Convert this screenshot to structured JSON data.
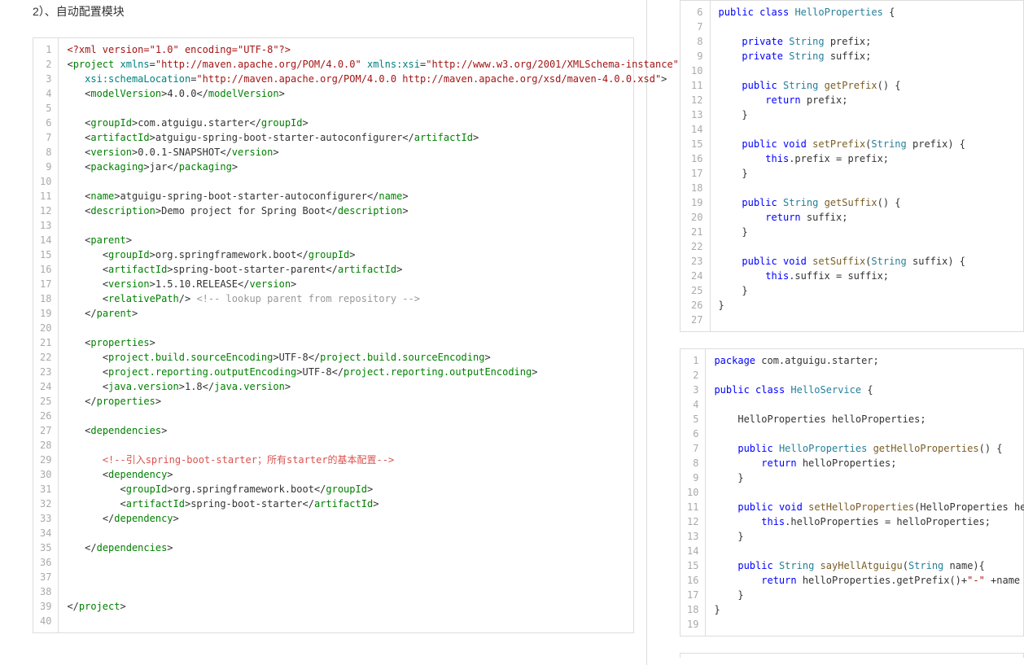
{
  "heading": "2）、自动配置模块",
  "xml": {
    "l1": "<?xml version=\"1.0\" encoding=\"UTF-8\"?>",
    "l2a": "project",
    "l2b": "xmlns",
    "l2c": "\"http://maven.apache.org/POM/4.0.0\"",
    "l2d": "xmlns:xsi",
    "l2e": "\"http://www.w3.org/2001/XMLSchema-instance\"",
    "l3a": "xsi:schemaLocation",
    "l3b": "\"http://maven.apache.org/POM/4.0.0 http://maven.apache.org/xsd/maven-4.0.0.xsd\"",
    "l4a": "modelVersion",
    "l4b": "4.0.0",
    "l6a": "groupId",
    "l6b": "com.atguigu.starter",
    "l7a": "artifactId",
    "l7b": "atguigu-spring-boot-starter-autoconfigurer",
    "l8a": "version",
    "l8b": "0.0.1-SNAPSHOT",
    "l9a": "packaging",
    "l9b": "jar",
    "l11a": "name",
    "l11b": "atguigu-spring-boot-starter-autoconfigurer",
    "l12a": "description",
    "l12b": "Demo project for Spring Boot",
    "l14": "parent",
    "l15a": "groupId",
    "l15b": "org.springframework.boot",
    "l16a": "artifactId",
    "l16b": "spring-boot-starter-parent",
    "l17a": "version",
    "l17b": "1.5.10.RELEASE",
    "l18a": "relativePath",
    "l18b": "<!-- lookup parent from repository -->",
    "l21": "properties",
    "l22a": "project.build.sourceEncoding",
    "l22b": "UTF-8",
    "l23a": "project.reporting.outputEncoding",
    "l23b": "UTF-8",
    "l24a": "java.version",
    "l24b": "1.8",
    "l27": "dependencies",
    "l29": "<!--引入spring-boot-starter；所有starter的基本配置-->",
    "l30": "dependency",
    "l31a": "groupId",
    "l31b": "org.springframework.boot",
    "l32a": "artifactId",
    "l32b": "spring-boot-starter"
  },
  "java1": {
    "l6": "public class HelloProperties {",
    "l8a": "private",
    "l8b": "String",
    "l8c": "prefix;",
    "l9a": "private",
    "l9b": "String",
    "l9c": "suffix;",
    "l11a": "public",
    "l11b": "String",
    "l11c": "getPrefix",
    "l11d": "() {",
    "l12": "        return prefix;",
    "l15a": "public",
    "l15b": "void",
    "l15c": "setPrefix",
    "l15d": "(",
    "l15e": "String",
    "l15f": " prefix) {",
    "l16": "        this.prefix = prefix;",
    "l19a": "public",
    "l19b": "String",
    "l19c": "getSuffix",
    "l19d": "() {",
    "l20": "        return suffix;",
    "l23a": "public",
    "l23b": "void",
    "l23c": "setSuffix",
    "l23d": "(",
    "l23e": "String",
    "l23f": " suffix) {",
    "l24": "        this.suffix = suffix;"
  },
  "java2": {
    "l1a": "package",
    "l1b": " com.atguigu.starter;",
    "l3": "public class HelloService {",
    "l5": "    HelloProperties helloProperties;",
    "l7a": "public",
    "l7b": "HelloProperties",
    "l7c": "getHelloProperties",
    "l7d": "() {",
    "l8": "        return helloProperties;",
    "l11a": "public",
    "l11b": "void",
    "l11c": "setHelloProperties",
    "l11d": "(HelloProperties helloProp",
    "l12": "        this.helloProperties = helloProperties;",
    "l15a": "public",
    "l15b": "String",
    "l15c": "sayHellAtguigu",
    "l15d": "(",
    "l15e": "String",
    "l15f": " name){",
    "l16a": "        return helloProperties.getPrefix()+",
    "l16b": "\"-\"",
    "l16c": " +name + hello"
  }
}
